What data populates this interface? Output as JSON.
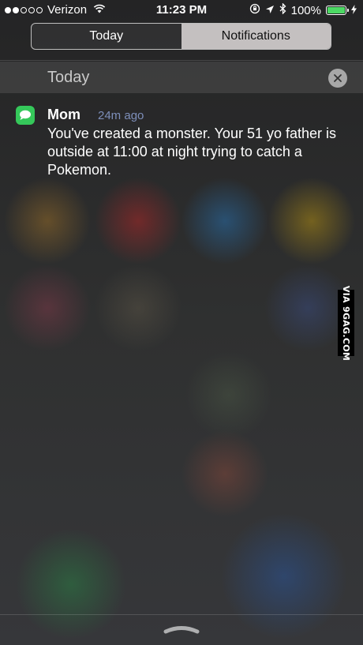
{
  "status_bar": {
    "carrier": "Verizon",
    "time": "11:23 PM",
    "battery": "100%",
    "battery_level": 1.0,
    "signal_bars_filled": 2,
    "signal_bars_total": 5
  },
  "segments": {
    "today_label": "Today",
    "notifications_label": "Notifications",
    "selected": "Notifications"
  },
  "section": {
    "title": "Today",
    "clear_icon": "close-icon"
  },
  "notification": {
    "app_icon": "messages-icon",
    "sender": "Mom",
    "time": "24m ago",
    "message": "You've created a monster. Your 51 yo father is outside at 11:00 at night trying to catch a Pokemon."
  },
  "watermark": "VIA 9GAG.COM",
  "colors": {
    "messages_green": "#35c85a",
    "battery_green": "#4cd964"
  }
}
